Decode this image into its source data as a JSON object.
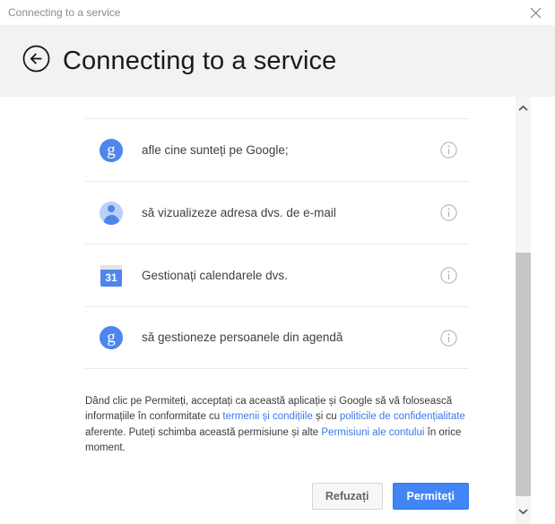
{
  "window": {
    "titlebar_text": "Connecting to a service",
    "close_icon": "close-icon"
  },
  "header": {
    "back_icon": "back-arrow-icon",
    "title": "Connecting to a service"
  },
  "permissions": [
    {
      "icon": "google-g-icon",
      "icon_text": "g",
      "label": "afle cine sunteți pe Google;",
      "info_icon": "info-icon"
    },
    {
      "icon": "person-avatar-icon",
      "icon_text": "",
      "label": "să vizualizeze adresa dvs. de e-mail",
      "info_icon": "info-icon"
    },
    {
      "icon": "google-calendar-icon",
      "icon_text": "31",
      "label": "Gestionați calendarele dvs.",
      "info_icon": "info-icon"
    },
    {
      "icon": "google-g-icon",
      "icon_text": "g",
      "label": "să gestioneze persoanele din agendă",
      "info_icon": "info-icon"
    }
  ],
  "disclaimer": {
    "part1": "Dând clic pe Permiteți, acceptați ca această aplicație și Google să vă folosească informațiile în conformitate cu ",
    "link1": "termenii și condițiile",
    "part2": " și cu ",
    "link2": "politicile de confidențialitate",
    "part3": " aferente. Puteți schimba această permisiune și alte ",
    "link3": "Permisiuni ale contului",
    "part4": " în orice moment."
  },
  "buttons": {
    "deny_label": "Refuzați",
    "allow_label": "Permiteți"
  },
  "scrollbar": {
    "up_icon": "chevron-up-icon",
    "down_icon": "chevron-down-icon"
  },
  "colors": {
    "accent_blue": "#4285f4",
    "link_blue": "#3b78e7",
    "header_band": "#f2f2f2",
    "scrollbar_thumb": "#c6c6c6"
  }
}
